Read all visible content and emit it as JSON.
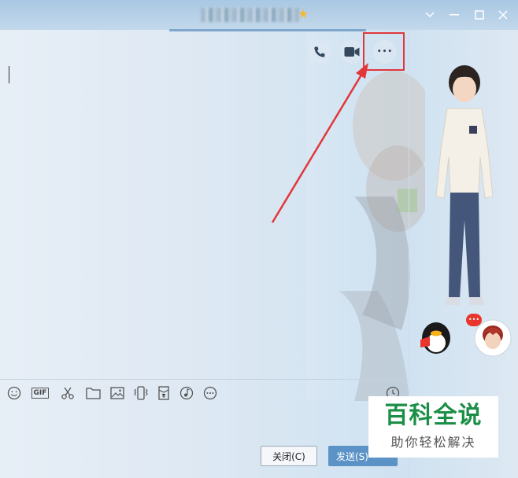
{
  "window": {
    "title_star_glyph": "★",
    "controls": {
      "settings_glyph": "⌄",
      "minimize_glyph": "—",
      "maximize_glyph": "□",
      "close_glyph": "✕"
    }
  },
  "chat_header_actions": [
    {
      "name": "voice-call",
      "icon": "phone-icon"
    },
    {
      "name": "video-call",
      "icon": "video-camera-icon"
    },
    {
      "name": "more",
      "icon": "more-dots-icon",
      "glyph": "•••"
    }
  ],
  "annotation": {
    "color": "#e2363a"
  },
  "toolbar": {
    "gif_label": "GIF",
    "items": [
      "emoji-icon",
      "gif-icon",
      "scissors-icon",
      "folder-icon",
      "image-icon",
      "shake-icon",
      "red-packet-icon",
      "music-icon",
      "more-icon",
      "history-clock-icon"
    ],
    "more_glyph": "⋯"
  },
  "buttons": {
    "close_label": "关闭(C)",
    "send_label": "发送(S)"
  },
  "watermark": {
    "title": "百科全说",
    "subtitle": "助你轻松解决"
  },
  "colors": {
    "accent": "#5b93c7",
    "titlebar": "#a9c8e3",
    "watermark_green": "#1b8f47"
  }
}
